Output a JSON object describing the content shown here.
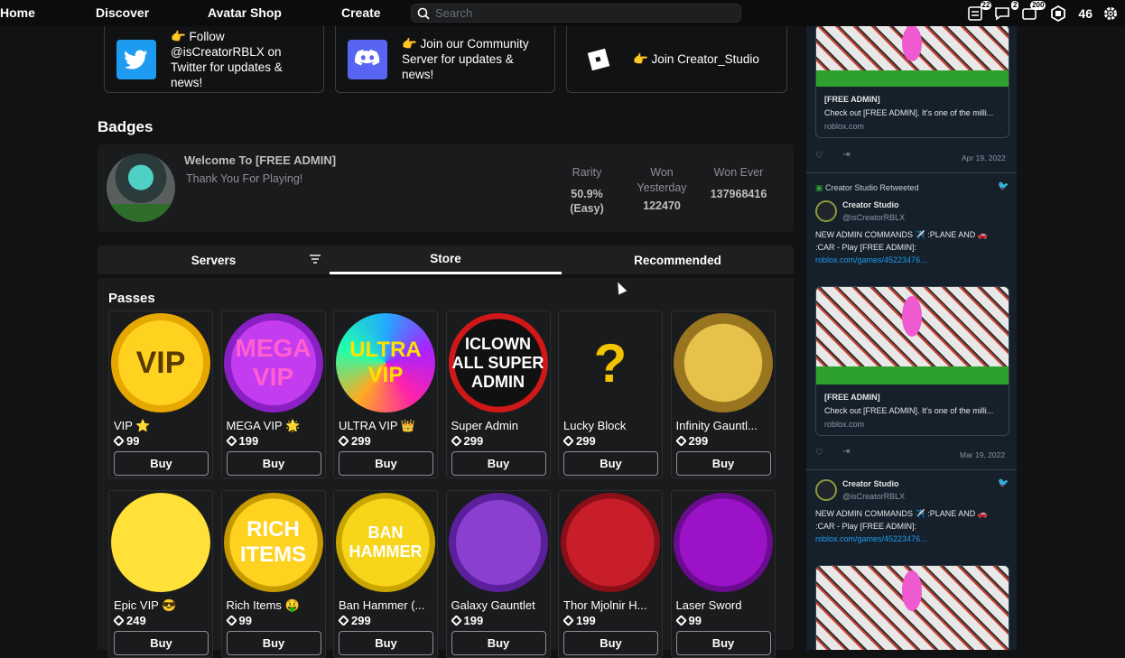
{
  "nav": {
    "home": "Home",
    "discover": "Discover",
    "avatar_shop": "Avatar Shop",
    "create": "Create",
    "search_placeholder": "Search",
    "badge_messages": "22",
    "badge_notifications": "2",
    "badge_friends": "200",
    "robux": "46"
  },
  "social": [
    {
      "text": "👉 Follow @isCreatorRBLX on Twitter for updates & news!",
      "lines": [
        "👉 Follow",
        "@isCreatorRBLX on",
        "Twitter for updates &",
        "news!"
      ]
    },
    {
      "lines": [
        "👉 Join our Community",
        "Server for updates &",
        "news!"
      ]
    },
    {
      "lines": [
        "👉 Join Creator_Studio"
      ]
    }
  ],
  "badges": {
    "heading": "Badges",
    "title": "Welcome To [FREE ADMIN]",
    "description": "Thank You For Playing!",
    "rarity_label": "Rarity",
    "rarity_value": "50.9%",
    "rarity_sub": "(Easy)",
    "won_yesterday_label1": "Won",
    "won_yesterday_label2": "Yesterday",
    "won_yesterday_value": "122470",
    "won_ever_label": "Won Ever",
    "won_ever_value": "137968416"
  },
  "tabs": {
    "servers": "Servers",
    "store": "Store",
    "recommended": "Recommended"
  },
  "store": {
    "heading": "Passes",
    "buy_label": "Buy",
    "passes": [
      {
        "name": "VIP ⭐",
        "price": "99"
      },
      {
        "name": "MEGA VIP 🌟",
        "price": "199"
      },
      {
        "name": "ULTRA VIP 👑",
        "price": "299"
      },
      {
        "name": "Super Admin",
        "price": "299"
      },
      {
        "name": "Lucky Block",
        "price": "299"
      },
      {
        "name": "Infinity Gauntl...",
        "price": "299"
      },
      {
        "name": "Epic VIP 😎",
        "price": "249"
      },
      {
        "name": "Rich Items 🤑",
        "price": "99"
      },
      {
        "name": "Ban Hammer (...",
        "price": "299"
      },
      {
        "name": "Galaxy Gauntlet",
        "price": "199"
      },
      {
        "name": "Thor Mjolnir H...",
        "price": "199"
      },
      {
        "name": "Laser Sword",
        "price": "99"
      }
    ],
    "thumb_text": [
      "VIP",
      "MEGA VIP",
      "ULTRA VIP",
      "ICLOWN ALL SUPER ADMIN",
      "?",
      "",
      "",
      "RICH ITEMS",
      "BAN HAMMER",
      "",
      "",
      ""
    ]
  },
  "feed": {
    "card_title": "[FREE ADMIN]",
    "card_desc": "Check out [FREE ADMIN]. It's one of the milli...",
    "card_domain": "roblox.com",
    "date1": "Apr 19, 2022",
    "date2": "Mar 19, 2022",
    "retweeted": "Creator Studio Retweeted",
    "author": "Creator Studio",
    "handle": "@isCreatorRBLX",
    "tweet_line1": "NEW ADMIN COMMANDS ✈️ :PLANE AND 🚗",
    "tweet_line2": ":CAR - Play [FREE ADMIN]:",
    "tweet_link": "roblox.com/games/45223476..."
  },
  "colors": {
    "bg": "#111214",
    "panel": "#1a1b1d",
    "twitter": "#1d9bf0",
    "discord": "#5865f2",
    "feed_bg": "#15202b"
  }
}
